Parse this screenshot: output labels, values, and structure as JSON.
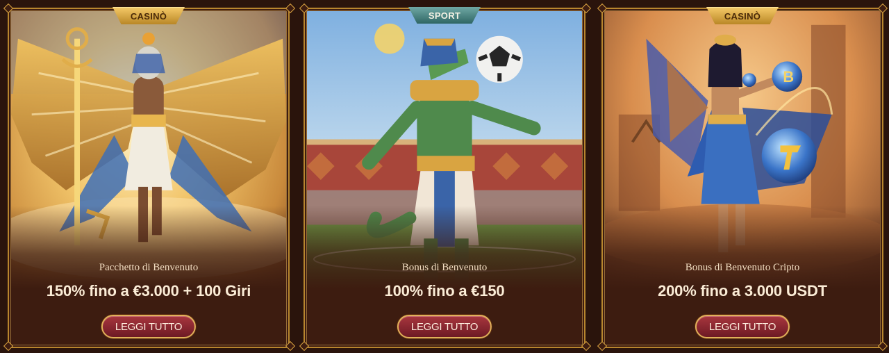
{
  "cards": [
    {
      "tag": "CASINÒ",
      "subtitle": "Pacchetto di Benvenuto",
      "headline": "150% fino a €3.000 + 100 Giri",
      "button": "LEGGI TUTTO"
    },
    {
      "tag": "SPORT",
      "subtitle": "Bonus di Benvenuto",
      "headline": "100% fino a €150",
      "button": "LEGGI TUTTO"
    },
    {
      "tag": "CASINÒ",
      "subtitle": "Bonus di Benvenuto Cripto",
      "headline": "200% fino a 3.000 USDT",
      "button": "LEGGI TUTTO"
    }
  ],
  "colors": {
    "background": "#2a140c",
    "card_bg": "#3d1c10",
    "gold_border": "#b8862e",
    "button": "#8a2530",
    "tag_casino": "#e0ad4a",
    "tag_sport": "#4c8684"
  }
}
